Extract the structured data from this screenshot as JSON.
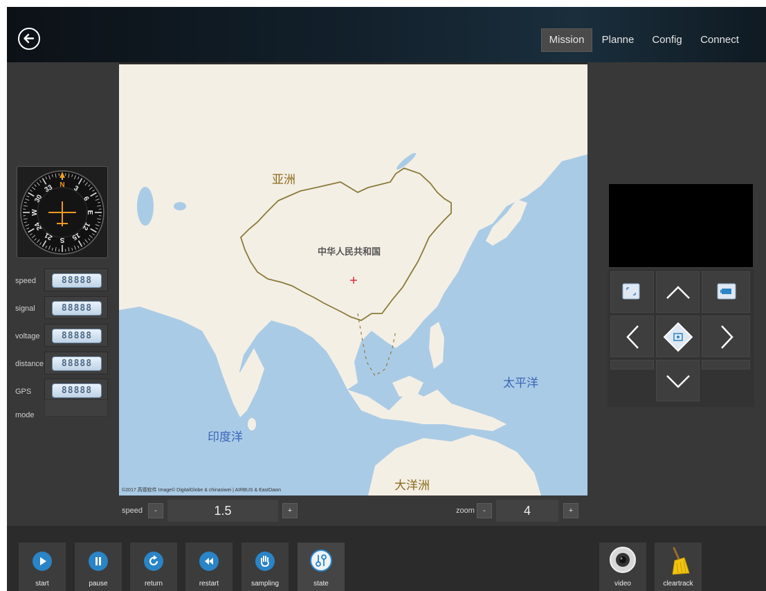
{
  "nav": {
    "items": [
      {
        "label": "Mission",
        "active": true
      },
      {
        "label": "Planne"
      },
      {
        "label": "Config"
      },
      {
        "label": "Connect"
      }
    ]
  },
  "instruments": {
    "compass_marks": [
      "N",
      "3",
      "6",
      "E",
      "12",
      "15",
      "S",
      "21",
      "24",
      "W",
      "30",
      "33"
    ],
    "rows": [
      {
        "label": "speed",
        "value": "88888"
      },
      {
        "label": "signal",
        "value": "88888"
      },
      {
        "label": "voltage",
        "value": "88888"
      },
      {
        "label": "distance",
        "value": "88888"
      },
      {
        "label": "GPS",
        "value": "88888"
      }
    ],
    "mode_label": "mode"
  },
  "map": {
    "labels": {
      "asia": "亚洲",
      "china": "中华人民共和国",
      "pacific": "太平洋",
      "indian": "印度洋",
      "oceania": "大洋洲"
    },
    "attribution": "©2017 高德软件 Image© DigitalGlobe & chinasiwei | AIRBUS & EastDawn"
  },
  "controls": {
    "speed": {
      "label": "speed",
      "value": "1.5",
      "minus": "-",
      "plus": "+"
    },
    "zoom": {
      "label": "zoom",
      "value": "4",
      "minus": "-",
      "plus": "+"
    }
  },
  "toolbar": {
    "left": [
      {
        "label": "start",
        "icon": "play-icon"
      },
      {
        "label": "pause",
        "icon": "pause-icon"
      },
      {
        "label": "return",
        "icon": "return-icon"
      },
      {
        "label": "restart",
        "icon": "rewind-icon"
      },
      {
        "label": "sampling",
        "icon": "hand-icon"
      },
      {
        "label": "state",
        "icon": "state-icon"
      }
    ],
    "right": [
      {
        "label": "video",
        "icon": "camera-icon"
      },
      {
        "label": "cleartrack",
        "icon": "broom-icon"
      }
    ]
  },
  "colors": {
    "accent": "#2a84c6",
    "map_water": "#aacbe6",
    "map_land": "#f4efe5",
    "border": "#8a7a3a",
    "label_gold": "#8a6a1a",
    "label_blue": "#3a66b8"
  }
}
